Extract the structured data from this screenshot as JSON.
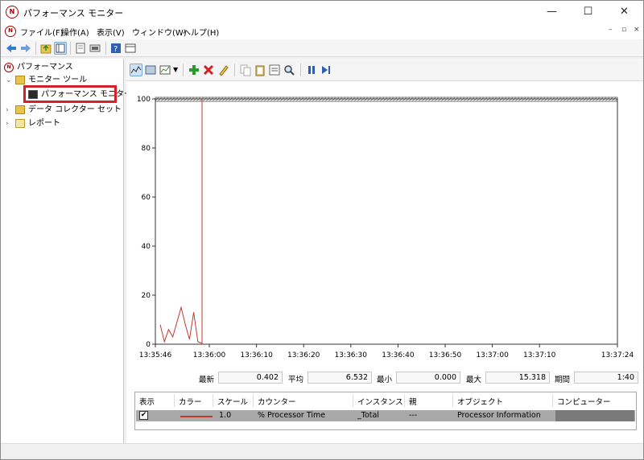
{
  "window": {
    "title": "パフォーマンス モニター"
  },
  "menu": {
    "items": [
      "ファイル(F)",
      "操作(A)",
      "表示(V)",
      "ウィンドウ(W)",
      "ヘルプ(H)"
    ],
    "mdi": [
      "–",
      "▫",
      "×"
    ]
  },
  "tree": {
    "root": "パフォーマンス",
    "monitor_tools": "モニター ツール",
    "perf_monitor": "パフォーマンス モニター",
    "data_collector": "データ コレクター セット",
    "reports": "レポート"
  },
  "chart_data": {
    "type": "line",
    "ylim": [
      0,
      100
    ],
    "y_ticks": [
      "100",
      "80",
      "60",
      "40",
      "20",
      "0"
    ],
    "x_ticks": [
      "13:35:46",
      "13:36:00",
      "13:36:10",
      "13:36:20",
      "13:36:30",
      "13:36:40",
      "13:36:50",
      "13:37:00",
      "13:37:10",
      "13:37:24"
    ],
    "series": [
      {
        "name": "% Processor Time",
        "color": "#c0392b",
        "values": [
          8,
          1,
          6,
          3,
          9,
          15,
          8,
          2,
          13,
          1,
          0.4,
          100
        ]
      }
    ]
  },
  "stats": {
    "latest_label": "最新",
    "latest": "0.402",
    "avg_label": "平均",
    "avg": "6.532",
    "min_label": "最小",
    "min": "0.000",
    "max_label": "最大",
    "max": "15.318",
    "duration_label": "期間",
    "duration": "1:40"
  },
  "legend": {
    "headers": [
      "表示",
      "カラー",
      "スケール",
      "カウンター",
      "インスタンス",
      "親",
      "オブジェクト",
      "コンピューター"
    ],
    "row": {
      "show": "✔",
      "scale": "1.0",
      "counter": "% Processor Time",
      "instance": "_Total",
      "parent": "---",
      "object": "Processor Information",
      "color": "#c0392b"
    }
  }
}
